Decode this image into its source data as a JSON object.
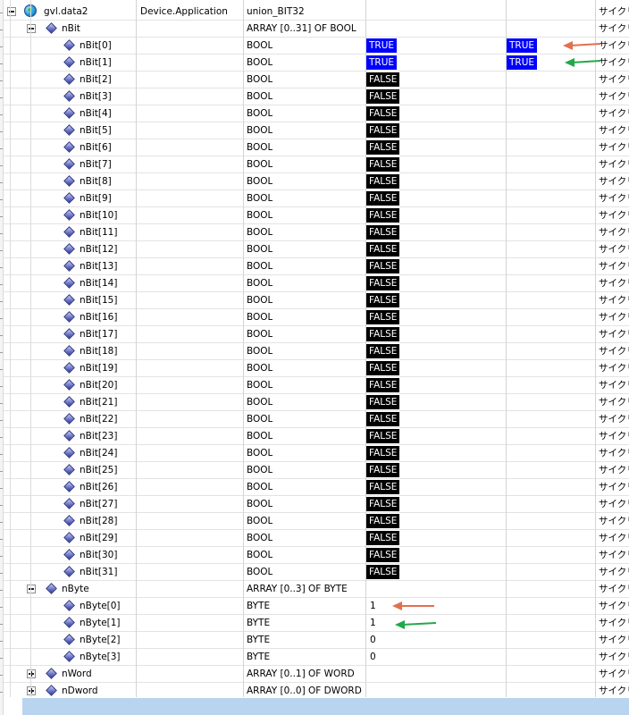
{
  "root": {
    "name": "gvl.data2",
    "application": "Device.Application",
    "type": "union_BIT32",
    "trailing": "サイクリ"
  },
  "nbit_group": {
    "name": "nBit",
    "type": "ARRAY [0..31] OF BOOL",
    "trailing": "サイクリ"
  },
  "nbit_items": [
    {
      "name": "nBit[0]",
      "type": "BOOL",
      "value": "TRUE",
      "prepared": "TRUE",
      "trailing": "サイクリ"
    },
    {
      "name": "nBit[1]",
      "type": "BOOL",
      "value": "TRUE",
      "prepared": "TRUE",
      "trailing": "サイクリ"
    },
    {
      "name": "nBit[2]",
      "type": "BOOL",
      "value": "FALSE",
      "prepared": "",
      "trailing": "サイクリ"
    },
    {
      "name": "nBit[3]",
      "type": "BOOL",
      "value": "FALSE",
      "prepared": "",
      "trailing": "サイクリ"
    },
    {
      "name": "nBit[4]",
      "type": "BOOL",
      "value": "FALSE",
      "prepared": "",
      "trailing": "サイクリ"
    },
    {
      "name": "nBit[5]",
      "type": "BOOL",
      "value": "FALSE",
      "prepared": "",
      "trailing": "サイクリ"
    },
    {
      "name": "nBit[6]",
      "type": "BOOL",
      "value": "FALSE",
      "prepared": "",
      "trailing": "サイクリ"
    },
    {
      "name": "nBit[7]",
      "type": "BOOL",
      "value": "FALSE",
      "prepared": "",
      "trailing": "サイクリ"
    },
    {
      "name": "nBit[8]",
      "type": "BOOL",
      "value": "FALSE",
      "prepared": "",
      "trailing": "サイクリ"
    },
    {
      "name": "nBit[9]",
      "type": "BOOL",
      "value": "FALSE",
      "prepared": "",
      "trailing": "サイクリ"
    },
    {
      "name": "nBit[10]",
      "type": "BOOL",
      "value": "FALSE",
      "prepared": "",
      "trailing": "サイクリ"
    },
    {
      "name": "nBit[11]",
      "type": "BOOL",
      "value": "FALSE",
      "prepared": "",
      "trailing": "サイクリ"
    },
    {
      "name": "nBit[12]",
      "type": "BOOL",
      "value": "FALSE",
      "prepared": "",
      "trailing": "サイクリ"
    },
    {
      "name": "nBit[13]",
      "type": "BOOL",
      "value": "FALSE",
      "prepared": "",
      "trailing": "サイクリ"
    },
    {
      "name": "nBit[14]",
      "type": "BOOL",
      "value": "FALSE",
      "prepared": "",
      "trailing": "サイクリ"
    },
    {
      "name": "nBit[15]",
      "type": "BOOL",
      "value": "FALSE",
      "prepared": "",
      "trailing": "サイクリ"
    },
    {
      "name": "nBit[16]",
      "type": "BOOL",
      "value": "FALSE",
      "prepared": "",
      "trailing": "サイクリ"
    },
    {
      "name": "nBit[17]",
      "type": "BOOL",
      "value": "FALSE",
      "prepared": "",
      "trailing": "サイクリ"
    },
    {
      "name": "nBit[18]",
      "type": "BOOL",
      "value": "FALSE",
      "prepared": "",
      "trailing": "サイクリ"
    },
    {
      "name": "nBit[19]",
      "type": "BOOL",
      "value": "FALSE",
      "prepared": "",
      "trailing": "サイクリ"
    },
    {
      "name": "nBit[20]",
      "type": "BOOL",
      "value": "FALSE",
      "prepared": "",
      "trailing": "サイクリ"
    },
    {
      "name": "nBit[21]",
      "type": "BOOL",
      "value": "FALSE",
      "prepared": "",
      "trailing": "サイクリ"
    },
    {
      "name": "nBit[22]",
      "type": "BOOL",
      "value": "FALSE",
      "prepared": "",
      "trailing": "サイクリ"
    },
    {
      "name": "nBit[23]",
      "type": "BOOL",
      "value": "FALSE",
      "prepared": "",
      "trailing": "サイクリ"
    },
    {
      "name": "nBit[24]",
      "type": "BOOL",
      "value": "FALSE",
      "prepared": "",
      "trailing": "サイクリ"
    },
    {
      "name": "nBit[25]",
      "type": "BOOL",
      "value": "FALSE",
      "prepared": "",
      "trailing": "サイクリ"
    },
    {
      "name": "nBit[26]",
      "type": "BOOL",
      "value": "FALSE",
      "prepared": "",
      "trailing": "サイクリ"
    },
    {
      "name": "nBit[27]",
      "type": "BOOL",
      "value": "FALSE",
      "prepared": "",
      "trailing": "サイクリ"
    },
    {
      "name": "nBit[28]",
      "type": "BOOL",
      "value": "FALSE",
      "prepared": "",
      "trailing": "サイクリ"
    },
    {
      "name": "nBit[29]",
      "type": "BOOL",
      "value": "FALSE",
      "prepared": "",
      "trailing": "サイクリ"
    },
    {
      "name": "nBit[30]",
      "type": "BOOL",
      "value": "FALSE",
      "prepared": "",
      "trailing": "サイクリ"
    },
    {
      "name": "nBit[31]",
      "type": "BOOL",
      "value": "FALSE",
      "prepared": "",
      "trailing": "サイクリ"
    }
  ],
  "nbyte_group": {
    "name": "nByte",
    "type": "ARRAY [0..3] OF BYTE",
    "trailing": "サイクリ"
  },
  "nbyte_items": [
    {
      "name": "nByte[0]",
      "type": "BYTE",
      "value": "1",
      "trailing": "サイクリ"
    },
    {
      "name": "nByte[1]",
      "type": "BYTE",
      "value": "1",
      "trailing": "サイクリ"
    },
    {
      "name": "nByte[2]",
      "type": "BYTE",
      "value": "0",
      "trailing": "サイクリ"
    },
    {
      "name": "nByte[3]",
      "type": "BYTE",
      "value": "0",
      "trailing": "サイクリ"
    }
  ],
  "collapsed_groups": [
    {
      "name": "nWord",
      "type": "ARRAY [0..1] OF WORD",
      "trailing": "サイクリ"
    },
    {
      "name": "nDword",
      "type": "ARRAY [0..0] OF DWORD",
      "trailing": "サイクリ"
    }
  ],
  "colors": {
    "true_bg": "#0000ff",
    "false_bg": "#000000",
    "arrow_orange": "#e0704f",
    "arrow_green": "#22a84a",
    "bottom_bar": "#b9d4ee"
  },
  "icons": {
    "root": "globe-icon",
    "variable": "diamond-variable-icon",
    "expander_open": "minus-box-icon",
    "expander_closed": "plus-box-icon",
    "annotation": "arrow-icon"
  }
}
